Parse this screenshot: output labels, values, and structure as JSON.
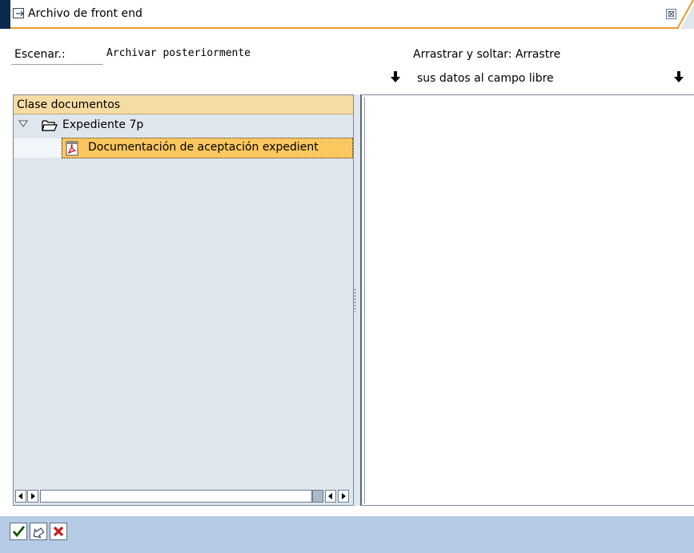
{
  "window": {
    "title": "Archivo de front end",
    "close_glyph": "⊠",
    "accent_color": "#e99a2a"
  },
  "scenario": {
    "label": "Escenar.:",
    "value": "Archivar posteriormente"
  },
  "dragdrop": {
    "line1": "Arrastrar y soltar: Arrastre",
    "line2": "sus datos al campo libre",
    "arrow_icon": "arrow-down-icon"
  },
  "tree": {
    "header": "Clase documentos",
    "folder": {
      "label": "Expediente 7p",
      "icon": "folder-open-icon",
      "expanded": true
    },
    "document": {
      "label": "Documentación de aceptación expedient",
      "icon": "pdf-document-icon",
      "selected": true
    }
  },
  "toolbar": {
    "buttons": [
      "check-icon",
      "continue-icon",
      "cancel-icon"
    ]
  },
  "colors": {
    "tree_header": "#f5dca5",
    "selection": "#fcc75e",
    "pane_bg": "#dfe6ee",
    "bottom_bar": "#b5cbe6",
    "titlebar_edge": "#0b2b4e"
  }
}
